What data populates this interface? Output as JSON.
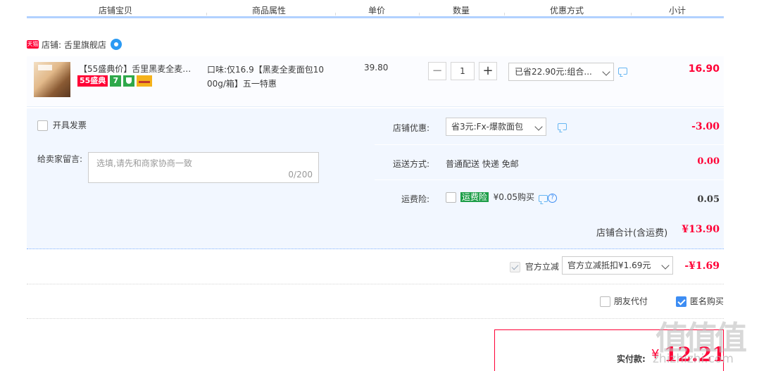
{
  "header": {
    "columns": [
      "店铺宝贝",
      "商品属性",
      "单价",
      "数量",
      "优惠方式",
      "小计"
    ]
  },
  "shop": {
    "badge": "天猫",
    "label": "店铺:",
    "name": "舌里旗舰店"
  },
  "item": {
    "title": "【55盛典价】舌里黑麦全麦面...",
    "badge_55": "55盛典",
    "badge_7": "7",
    "attr_line1": "口味:仅16.9【黑麦全麦面包10",
    "attr_line2": "00g/箱】五一特惠",
    "unit_price": "39.80",
    "quantity": "1",
    "qty_minus": "−",
    "qty_plus": "+",
    "promo": "已省22.90元:组合...",
    "subtotal": "16.90"
  },
  "options": {
    "invoice_label": "开具发票",
    "message_label": "给卖家留言:",
    "message_placeholder": "选填,请先和商家协商一致",
    "message_count": "0/200",
    "shop_discount_label": "店铺优惠:",
    "shop_discount_value": "省3元:Fx-爆款面包",
    "shop_discount_amount": "-3.00",
    "shipping_label": "运送方式:",
    "shipping_value": "普通配送 快递 免邮",
    "shipping_amount": "0.00",
    "insurance_label": "运费险:",
    "insurance_name": "运费险",
    "insurance_price": "¥0.05购买",
    "insurance_help": "?",
    "insurance_amount": "0.05",
    "shop_total_label": "店铺合计(含运费)",
    "shop_total_value": "¥13.90"
  },
  "official": {
    "label": "官方立减",
    "select_value": "官方立减抵扣¥1.69元",
    "amount": "-¥1.69"
  },
  "pay_options": {
    "friend_pay": "朋友代付",
    "anonymous": "匿名购买"
  },
  "payment": {
    "label": "实付款:",
    "currency": "¥",
    "value": "12.21"
  },
  "watermark": {
    "big": "值值值",
    "small": "zhizhizhi.com"
  }
}
